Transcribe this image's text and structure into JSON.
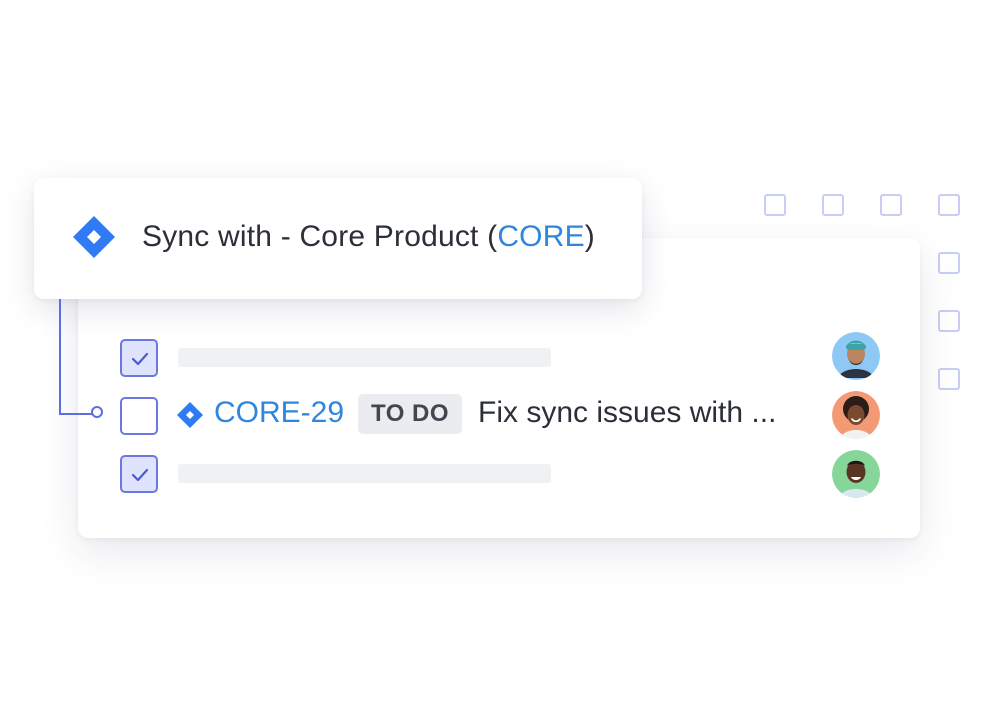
{
  "header": {
    "title_prefix": "Sync with - Core Product (",
    "project_key": "CORE",
    "title_suffix": ")",
    "logo_icon": "jira-logo-icon"
  },
  "tasks": [
    {
      "checked": true,
      "avatar_icon": "user-avatar-icon"
    },
    {
      "checked": false,
      "issue_key": "CORE-29",
      "status": "TO DO",
      "summary": "Fix sync issues with ...",
      "avatar_icon": "user-avatar-icon"
    },
    {
      "checked": true,
      "avatar_icon": "user-avatar-icon"
    }
  ],
  "colors": {
    "accent": "#2e86de",
    "jira_blue": "#2f7bf5",
    "checkbox_border": "#6a78e2",
    "checkbox_fill": "#dfe3fb",
    "connector": "#5b6ee8",
    "badge_bg": "#ebecf0",
    "avatar_bg_1": "#8ec8f5",
    "avatar_bg_2": "#f39a74",
    "avatar_bg_3": "#86d69a"
  }
}
